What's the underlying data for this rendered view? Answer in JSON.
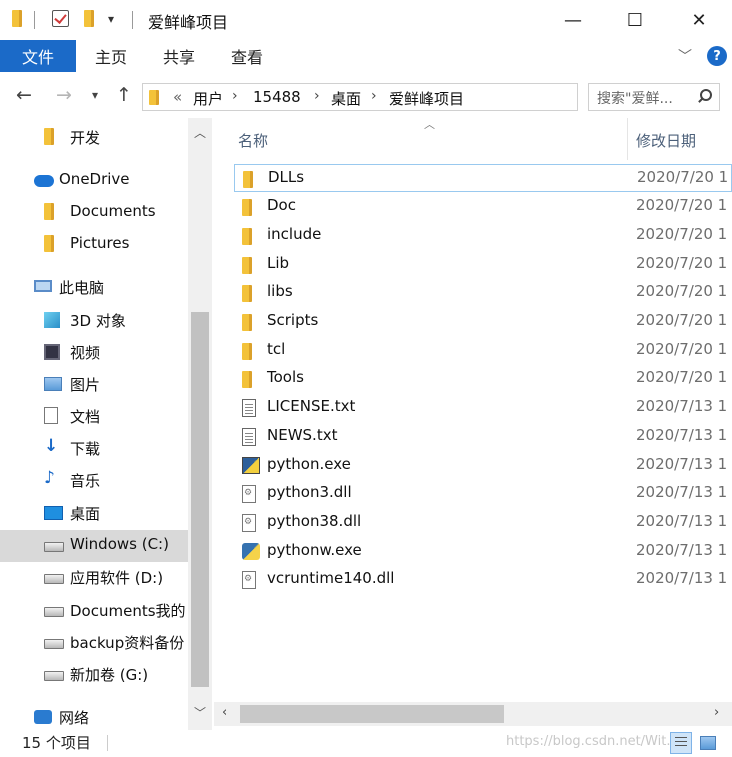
{
  "window": {
    "title": "爱鲜峰项目",
    "minimize_glyph": "—",
    "maximize_glyph": "☐",
    "close_glyph": "✕"
  },
  "ribbon": {
    "tabs": [
      "文件",
      "主页",
      "共享",
      "查看"
    ],
    "help_label": "?"
  },
  "address": {
    "overflow": "«",
    "crumbs": [
      "用户",
      "15488",
      "桌面",
      "爱鲜峰项目"
    ]
  },
  "search": {
    "placeholder": "搜索\"爱鲜..."
  },
  "nav": {
    "items": [
      {
        "label": "开发",
        "icon": "folder-icon"
      },
      {
        "label": "OneDrive",
        "icon": "onedrive-cloud-icon"
      },
      {
        "label": "Documents",
        "icon": "folder-icon"
      },
      {
        "label": "Pictures",
        "icon": "folder-icon"
      },
      {
        "label": "此电脑",
        "icon": "this-pc-icon"
      },
      {
        "label": "3D 对象",
        "icon": "3d-objects-icon"
      },
      {
        "label": "视频",
        "icon": "video-icon"
      },
      {
        "label": "图片",
        "icon": "pictures-icon"
      },
      {
        "label": "文档",
        "icon": "document-icon"
      },
      {
        "label": "下载",
        "icon": "download-arrow-icon"
      },
      {
        "label": "音乐",
        "icon": "music-note-icon"
      },
      {
        "label": "桌面",
        "icon": "desktop-icon"
      },
      {
        "label": "Windows (C:)",
        "icon": "drive-icon"
      },
      {
        "label": "应用软件 (D:)",
        "icon": "drive-icon"
      },
      {
        "label": "Documents我的",
        "icon": "drive-icon"
      },
      {
        "label": "backup资料备份",
        "icon": "drive-icon"
      },
      {
        "label": "新加卷 (G:)",
        "icon": "drive-icon"
      },
      {
        "label": "网络",
        "icon": "network-icon"
      }
    ],
    "selected": "Windows (C:)"
  },
  "columns": {
    "name": "名称",
    "date": "修改日期"
  },
  "files": [
    {
      "name": "DLLs",
      "date": "2020/7/20 1",
      "type": "folder"
    },
    {
      "name": "Doc",
      "date": "2020/7/20 1",
      "type": "folder"
    },
    {
      "name": "include",
      "date": "2020/7/20 1",
      "type": "folder"
    },
    {
      "name": "Lib",
      "date": "2020/7/20 1",
      "type": "folder"
    },
    {
      "name": "libs",
      "date": "2020/7/20 1",
      "type": "folder"
    },
    {
      "name": "Scripts",
      "date": "2020/7/20 1",
      "type": "folder"
    },
    {
      "name": "tcl",
      "date": "2020/7/20 1",
      "type": "folder"
    },
    {
      "name": "Tools",
      "date": "2020/7/20 1",
      "type": "folder"
    },
    {
      "name": "LICENSE.txt",
      "date": "2020/7/13 1",
      "type": "txt"
    },
    {
      "name": "NEWS.txt",
      "date": "2020/7/13 1",
      "type": "txt"
    },
    {
      "name": "python.exe",
      "date": "2020/7/13 1",
      "type": "exe"
    },
    {
      "name": "python3.dll",
      "date": "2020/7/13 1",
      "type": "dll"
    },
    {
      "name": "python38.dll",
      "date": "2020/7/13 1",
      "type": "dll"
    },
    {
      "name": "pythonw.exe",
      "date": "2020/7/13 1",
      "type": "exew"
    },
    {
      "name": "vcruntime140.dll",
      "date": "2020/7/13 1",
      "type": "dll"
    }
  ],
  "status": {
    "count": "15 个项目",
    "watermark": "https://blog.csdn.net/Wit..."
  },
  "colors": {
    "accent": "#1b6ac8",
    "folder": "#f0c040",
    "selected_row": "#d9d9d9"
  }
}
